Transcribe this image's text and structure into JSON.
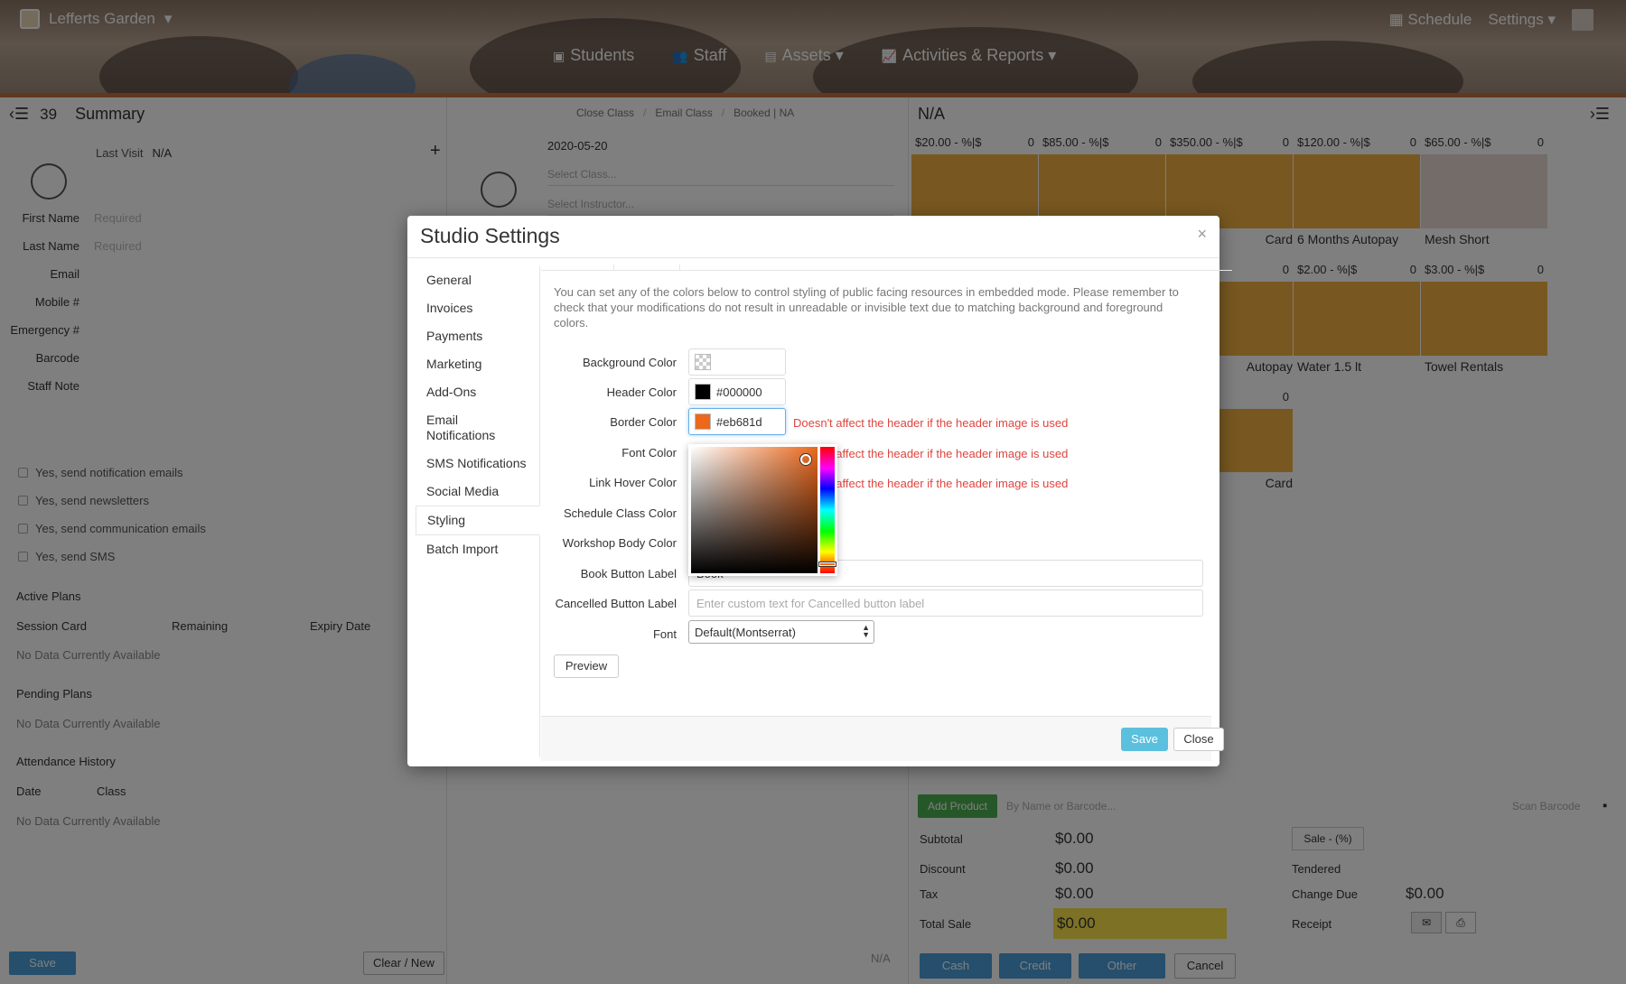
{
  "app": {
    "studio_name": "Lefferts Garden",
    "studio_caret": "▾",
    "schedule": "Schedule",
    "settings": "Settings ▾",
    "nav": [
      {
        "icon": "▣",
        "label": "Students"
      },
      {
        "icon": "👥",
        "label": "Staff"
      },
      {
        "icon": "▤",
        "label": "Assets ▾"
      },
      {
        "icon": "📈",
        "label": "Activities & Reports ▾"
      }
    ]
  },
  "left": {
    "count": "39",
    "title": "Summary",
    "last_visit_label": "Last Visit",
    "last_visit_value": "N/A",
    "fields": [
      {
        "label": "First Name",
        "value": "Required"
      },
      {
        "label": "Last Name",
        "value": "Required"
      },
      {
        "label": "Email",
        "value": ""
      },
      {
        "label": "Mobile #",
        "value": ""
      },
      {
        "label": "Emergency #",
        "value": ""
      },
      {
        "label": "Barcode",
        "value": ""
      },
      {
        "label": "Staff Note",
        "value": ""
      }
    ],
    "checks": [
      "Yes, send notification emails",
      "Yes, send newsletters",
      "Yes, send communication emails",
      "Yes, send SMS"
    ],
    "active_plans": "Active Plans",
    "plan_cols": [
      "Session Card",
      "Remaining",
      "Expiry Date"
    ],
    "no_data": "No Data Currently Available",
    "pending_plans": "Pending Plans",
    "attendance": "Attendance History",
    "att_cols": [
      "Date",
      "Class"
    ],
    "save": "Save",
    "clear": "Clear / New"
  },
  "mid": {
    "crumbs": [
      "Close Class",
      "Email Class",
      "Booked | NA"
    ],
    "date": "2020-05-20",
    "select_class": "Select Class...",
    "select_instructor": "Select Instructor...",
    "na": "N/A"
  },
  "right": {
    "title": "N/A",
    "products_row1": [
      {
        "price": "$20.00 - %|$",
        "qty": "0",
        "name": "",
        "color": "#f0b040"
      },
      {
        "price": "$85.00 - %|$",
        "qty": "0",
        "name": "",
        "color": "#f0b040"
      },
      {
        "price": "$350.00 - %|$",
        "qty": "0",
        "name": "Card",
        "color": "#f0b040"
      },
      {
        "price": "$120.00 - %|$",
        "qty": "0",
        "name": "6 Months Autopay",
        "color": "#f0b040"
      },
      {
        "price": "$65.00 - %|$",
        "qty": "0",
        "name": "Mesh Short",
        "color": "#e8d8d0"
      }
    ],
    "products_row2": [
      {
        "price": "- %|$",
        "qty": "0",
        "name": "Autopay"
      },
      {
        "price": "$2.00 - %|$",
        "qty": "0",
        "name": "Water 1.5 lt"
      },
      {
        "price": "$3.00 - %|$",
        "qty": "0",
        "name": "Towel Rentals"
      }
    ],
    "products_row3": [
      {
        "price": "- %|$",
        "qty": "0",
        "name": "Card"
      }
    ],
    "add_product": "Add Product",
    "search_ph": "By Name or Barcode...",
    "scan": "Scan Barcode",
    "subtotal_label": "Subtotal",
    "subtotal": "$0.00",
    "discount_label": "Discount",
    "discount": "$0.00",
    "tax_label": "Tax",
    "tax": "$0.00",
    "total_label": "Total Sale",
    "total": "$0.00",
    "sale_pct": "Sale - (%)",
    "tendered": "Tendered",
    "change_due_label": "Change Due",
    "change_due": "$0.00",
    "receipt": "Receipt",
    "pay": [
      "Cash",
      "Credit",
      "Other"
    ],
    "cancel": "Cancel"
  },
  "modal": {
    "title": "Studio Settings",
    "close_x": "×",
    "menu": [
      "General",
      "Invoices",
      "Payments",
      "Marketing",
      "Add-Ons",
      "Email Notifications",
      "SMS Notifications",
      "Social Media",
      "Styling",
      "Batch Import"
    ],
    "active_menu": "Styling",
    "description": "You can set any of the colors below to control styling of public facing resources in embedded mode. Please remember to check that your modifications do not result in unreadable or invisible text due to matching background and foreground colors.",
    "color_fields": [
      {
        "label": "Background Color",
        "value": "",
        "swatch": "transparent",
        "warning": ""
      },
      {
        "label": "Header Color",
        "value": "#000000",
        "swatch": "#000000",
        "warning": ""
      },
      {
        "label": "Border Color",
        "value": "#eb681d",
        "swatch": "#eb681d",
        "warning": "Doesn't affect the header if the header image is used"
      },
      {
        "label": "Font Color",
        "value": "",
        "swatch": "",
        "warning": "Doesn't affect the header if the header image is used"
      },
      {
        "label": "Link Hover Color",
        "value": "",
        "swatch": "",
        "warning": "Doesn't affect the header if the header image is used"
      },
      {
        "label": "Schedule Class Color",
        "value": "",
        "swatch": "",
        "warning": ""
      },
      {
        "label": "Workshop Body Color",
        "value": "",
        "swatch": "",
        "warning": ""
      }
    ],
    "book_label": "Book Button Label",
    "book_value": "Book",
    "cancelled_label": "Cancelled Button Label",
    "cancelled_placeholder": "Enter custom text for Cancelled button label",
    "font_label": "Font",
    "font_value": "Default(Montserrat)",
    "preview": "Preview",
    "save": "Save",
    "close": "Close"
  }
}
